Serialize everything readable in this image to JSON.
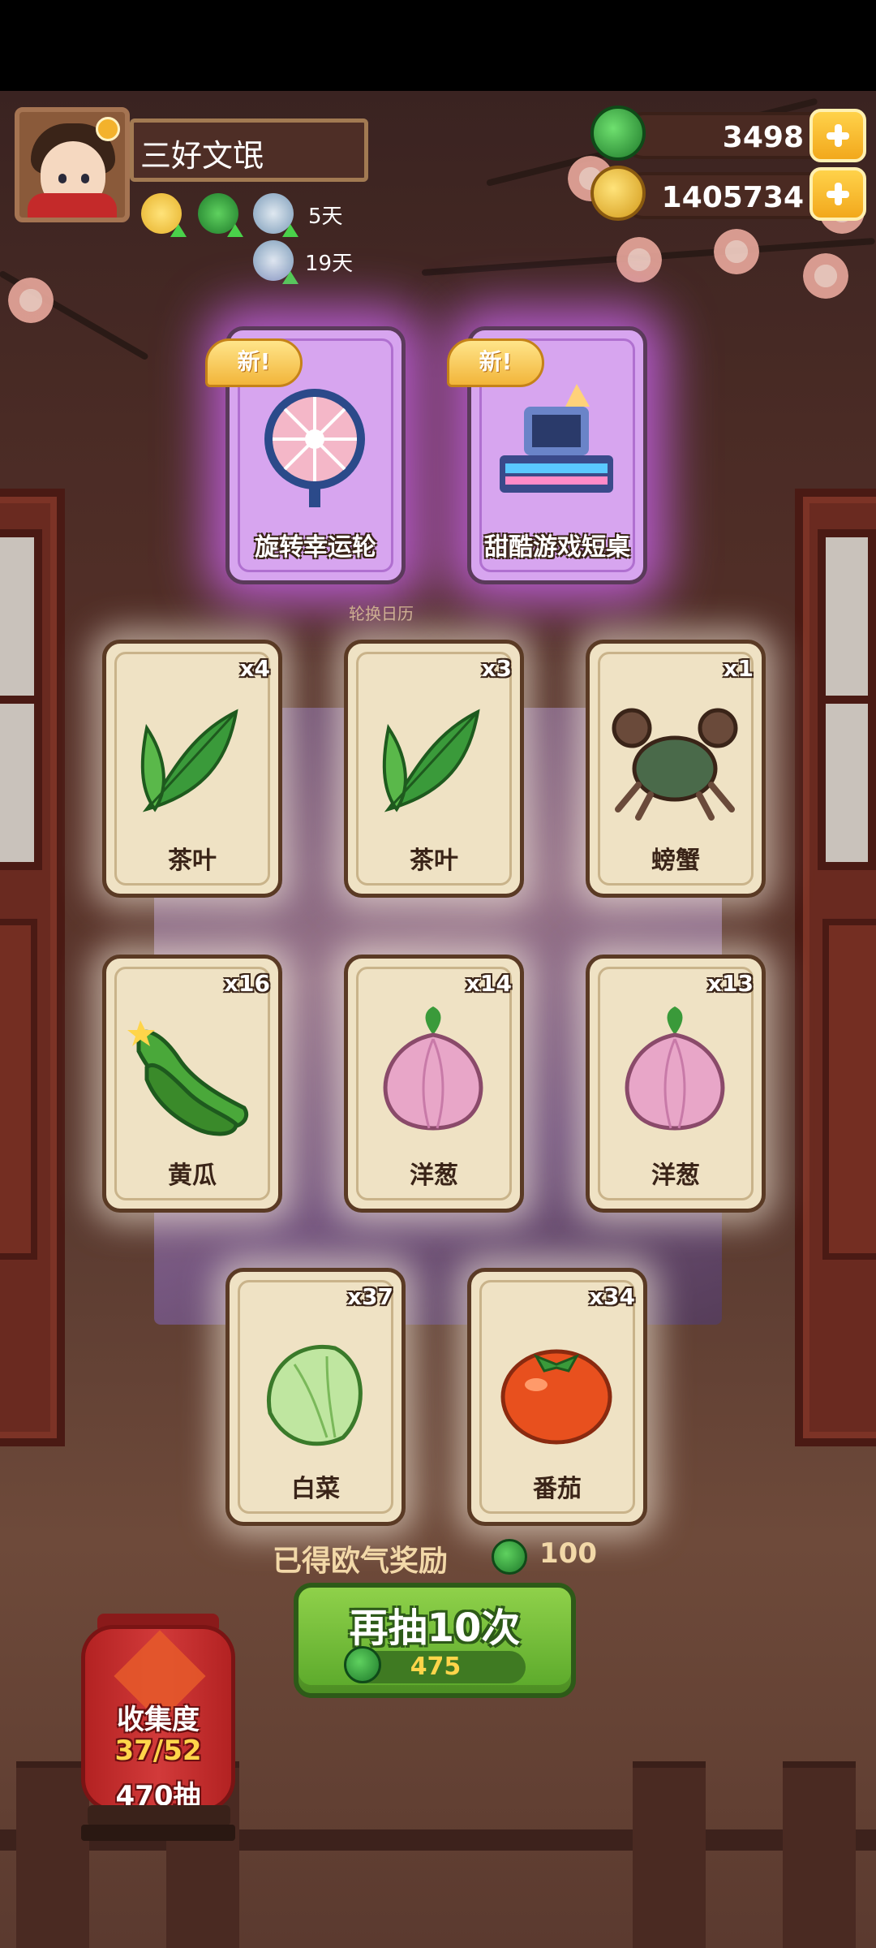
{
  "player": {
    "name": "三好文氓",
    "buffs": [
      {
        "icon": "coin-boost-icon",
        "days": ""
      },
      {
        "icon": "jade-boost-icon",
        "days": ""
      },
      {
        "icon": "bowl-boost-icon",
        "days": "5天"
      },
      {
        "icon": "bowl-boost-icon-2",
        "days": "19天"
      }
    ]
  },
  "currencies": [
    {
      "icon": "jade-coin-icon",
      "value": "3498",
      "color": "#2fae3a"
    },
    {
      "icon": "copper-coin-icon",
      "value": "1405734",
      "color": "#e6b12a"
    }
  ],
  "calendar_label": "轮换日历",
  "special_cards": [
    {
      "badge": "新!",
      "label": "旋转幸运轮",
      "icon": "lucky-wheel-icon"
    },
    {
      "badge": "新!",
      "label": "甜酷游戏短桌",
      "icon": "arcade-desk-icon"
    }
  ],
  "cards": [
    {
      "label": "茶叶",
      "count": "x4",
      "icon": "tea-leaf-icon"
    },
    {
      "label": "茶叶",
      "count": "x3",
      "icon": "tea-leaf-icon"
    },
    {
      "label": "螃蟹",
      "count": "x1",
      "icon": "crab-icon"
    },
    {
      "label": "黄瓜",
      "count": "x16",
      "icon": "cucumber-icon"
    },
    {
      "label": "洋葱",
      "count": "x14",
      "icon": "onion-icon"
    },
    {
      "label": "洋葱",
      "count": "x13",
      "icon": "onion-icon"
    },
    {
      "label": "白菜",
      "count": "x37",
      "icon": "cabbage-icon"
    },
    {
      "label": "番茄",
      "count": "x34",
      "icon": "tomato-icon"
    }
  ],
  "reward": {
    "label": "已得欧气奖励",
    "value": "100"
  },
  "draw_button": {
    "label": "再抽10次",
    "cost": "475"
  },
  "collection": {
    "title": "收集度",
    "progress": "37/52",
    "draws": "470抽"
  }
}
